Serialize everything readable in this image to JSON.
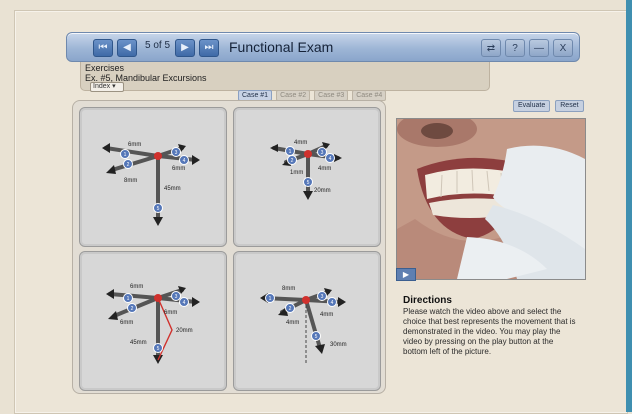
{
  "header": {
    "counter": "5 of 5",
    "title": "Functional Exam",
    "nav": {
      "first_icon": "skip-first-icon",
      "prev_icon": "prev-icon",
      "next_icon": "next-icon",
      "last_icon": "skip-last-icon"
    },
    "window_buttons": {
      "transfer_icon": "swap-icon",
      "help_label": "?",
      "minimize_label": "—",
      "close_label": "X"
    }
  },
  "info": {
    "line1": "Exercises",
    "line2": "Ex. #5, Mandibular Excursions",
    "index_label": "Index ▾"
  },
  "tabs": [
    "Case #1",
    "Case #2",
    "Case #3",
    "Case #4"
  ],
  "actions": {
    "evaluate_label": "Evaluate",
    "reset_label": "Reset"
  },
  "choices": [
    {
      "labels": {
        "a": "6mm",
        "b": "6mm",
        "c": "8mm",
        "d": "45mm"
      },
      "badges": {
        "b1": "1",
        "b2": "2",
        "b3": "3",
        "b4": "4",
        "b5": "5"
      }
    },
    {
      "labels": {
        "a": "4mm",
        "b": "1mm",
        "c": "4mm",
        "d": "20mm"
      },
      "badges": {
        "b1": "1",
        "b2": "2",
        "b3": "3",
        "b4": "4",
        "b5": "5"
      }
    },
    {
      "labels": {
        "a": "6mm",
        "b": "6mm",
        "c": "6mm",
        "d": "45mm",
        "e": "20mm"
      },
      "badges": {
        "b1": "1",
        "b2": "2",
        "b3": "3",
        "b4": "4",
        "b5": "5"
      }
    },
    {
      "labels": {
        "a": "8mm",
        "b": "4mm",
        "c": "4mm",
        "d": "30mm"
      },
      "badges": {
        "b1": "1",
        "b2": "2",
        "b3": "3",
        "b4": "4",
        "b5": "5"
      }
    }
  ],
  "video": {
    "play_icon": "play-icon"
  },
  "directions": {
    "heading": "Directions",
    "body": "Please watch the video above and select the choice that best represents the movement that is demonstrated in the video. You may play the video by pressing on the play button at the bottom left of the picture."
  },
  "colors": {
    "titlebar_blue": "#9eb6d6",
    "nav_blue": "#3f6aa7",
    "accent_red": "#d0312d"
  }
}
